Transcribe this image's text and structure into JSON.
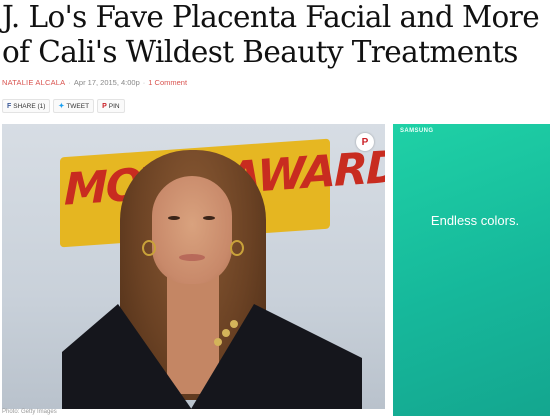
{
  "article": {
    "headline": "J. Lo's Fave Placenta Facial and More of Cali's Wildest Beauty Treatments",
    "author": "NATALIE ALCALA",
    "date": "Apr 17, 2015, 4:00p",
    "comments": "1 Comment",
    "photo_alt": "Jennifer Lopez at the MTV Movie Awards",
    "photo_credit": "Photo: Getty Images",
    "photo_sign_text": "MOVIE AWARDS"
  },
  "share": {
    "facebook": "SHARE (1)",
    "twitter": "TWEET",
    "pinterest": "PIN"
  },
  "pin_badge": "P",
  "ad": {
    "brand": "SAMSUNG",
    "tagline": "Endless colors."
  },
  "colors": {
    "accent": "#d9534f",
    "ad_green": "#1fd1a6"
  }
}
